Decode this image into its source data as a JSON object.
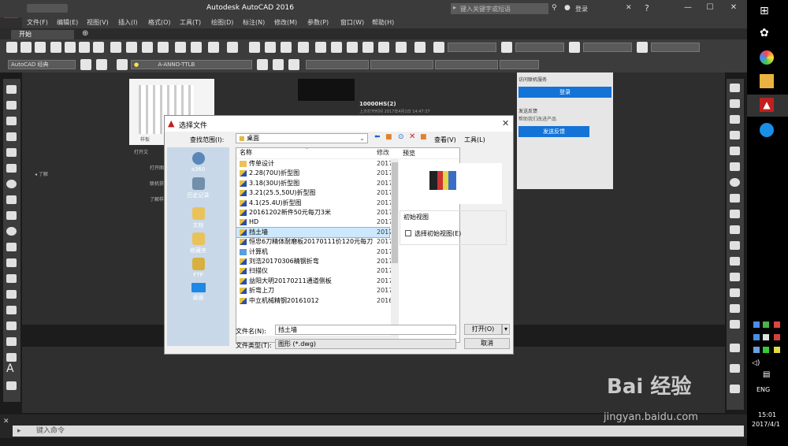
{
  "app": {
    "title": "Autodesk AutoCAD 2016",
    "search_placeholder": "键入关键字或短语",
    "login": "登录",
    "menu": [
      "文件(F)",
      "编辑(E)",
      "视图(V)",
      "插入(I)",
      "格式(O)",
      "工具(T)",
      "绘图(D)",
      "标注(N)",
      "修改(M)",
      "参数(P)",
      "窗口(W)",
      "帮助(H)"
    ],
    "tab_start": "开始",
    "workspace_dropdown": "AutoCAD 经典",
    "layer_dropdown": "A-ANNO-TTLB"
  },
  "startpage": {
    "left_item": "了解",
    "links": [
      "打开文",
      "打开图",
      "联机获",
      "了解样"
    ],
    "recent_file": "10000HS(2)",
    "recent_meta": "上次打开时间 2017年4月1日 14:47:37",
    "thumb_caption": "样板",
    "online_services": "访问联机服务",
    "login_btn": "登录",
    "feedback_title": "发送反馈",
    "feedback_desc": "帮助我们改进产品",
    "feedback_btn": "发送反馈"
  },
  "dialog": {
    "title": "选择文件",
    "look_in_label": "查找范围(I):",
    "look_in_value": "桌面",
    "views_label": "查看(V)",
    "tools_label": "工具(L)",
    "places": [
      "a360",
      "历史记录",
      "文档",
      "收藏夹",
      "FTP",
      "桌面"
    ],
    "col_name": "名称",
    "col_date": "修改",
    "files": [
      {
        "name": "传单设计",
        "date": "2017",
        "type": "folder"
      },
      {
        "name": "2.28(70U)折型图",
        "date": "2017",
        "type": "dwg"
      },
      {
        "name": "3.18(30U)折型图",
        "date": "2017",
        "type": "dwg"
      },
      {
        "name": "3.21(25.5,50U)折型图",
        "date": "2017",
        "type": "dwg"
      },
      {
        "name": "4.1(25.4U)折型图",
        "date": "2017",
        "type": "dwg"
      },
      {
        "name": "20161202新件50元每刀3米",
        "date": "2017",
        "type": "dwg"
      },
      {
        "name": "HD",
        "date": "2017",
        "type": "dwg"
      },
      {
        "name": "挡土墙",
        "date": "2017",
        "type": "dwg",
        "selected": true
      },
      {
        "name": "恒忠6刀精体耐磨板20170111价120元每刀",
        "date": "2017",
        "type": "dwg"
      },
      {
        "name": "计算机",
        "date": "2017",
        "type": "pc"
      },
      {
        "name": "刘浩20170306精钢折弯",
        "date": "2017",
        "type": "dwg"
      },
      {
        "name": "扫描仪",
        "date": "2017",
        "type": "dwg"
      },
      {
        "name": "益阳大明20170211通道侧板",
        "date": "2017",
        "type": "dwg"
      },
      {
        "name": "折弯上刀",
        "date": "2017",
        "type": "dwg"
      },
      {
        "name": "中立机械精钢20161012",
        "date": "2016",
        "type": "dwg"
      }
    ],
    "preview_label": "预览",
    "initial_view_label": "初始视图",
    "select_initial_view": "选择初始视图(E)",
    "filename_label": "文件名(N):",
    "filename_value": "挡土墙",
    "filetype_label": "文件类型(T):",
    "filetype_value": "图形 (*.dwg)",
    "open_btn": "打开(O)",
    "cancel_btn": "取消"
  },
  "command": {
    "placeholder": "键入命令"
  },
  "taskbar": {
    "lang": "ENG",
    "time": "15:01",
    "date": "2017/4/1"
  },
  "watermark": {
    "brand": "Bai 经验",
    "url": "jingyan.baidu.com"
  }
}
